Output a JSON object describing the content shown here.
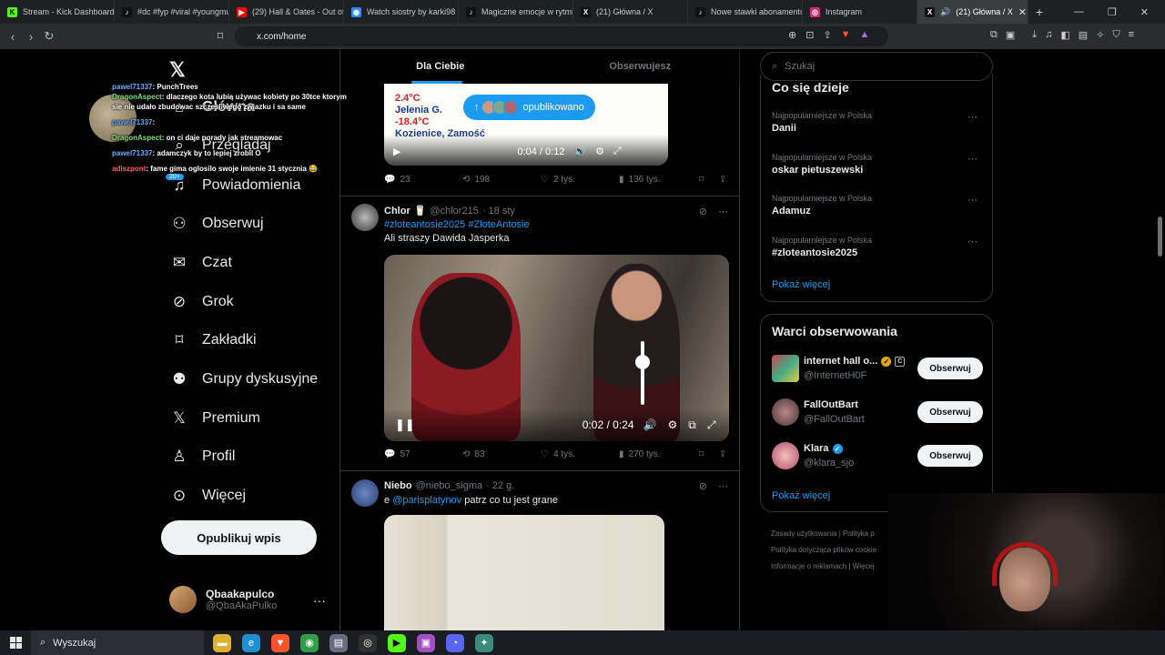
{
  "browser": {
    "tabs": [
      {
        "label": "Stream - Kick Dashboard",
        "favicon_color": "#53fc18",
        "favicon_glyph": "K"
      },
      {
        "label": "#dc #fyp #viral #youngmu",
        "favicon_color": "#111111",
        "favicon_glyph": "♪"
      },
      {
        "label": "(29) Hall & Oates - Out of",
        "favicon_color": "#ff0000",
        "favicon_glyph": "▶"
      },
      {
        "label": "Watch siostry by karki98",
        "favicon_color": "#2a8cff",
        "favicon_glyph": "◉"
      },
      {
        "label": "Magiczne emocje w rytmie",
        "favicon_color": "#111111",
        "favicon_glyph": "♪"
      },
      {
        "label": "(21) Główna / X",
        "favicon_color": "#111111",
        "favicon_glyph": "X"
      },
      {
        "label": "Nowe stawki abonamentu",
        "favicon_color": "#111111",
        "favicon_glyph": "♪"
      },
      {
        "label": "Instagram",
        "favicon_color": "#d62976",
        "favicon_glyph": "◎"
      }
    ],
    "active_tab": {
      "label": "(21) Główna / X",
      "favicon_glyph": "X"
    },
    "url": "x.com/home"
  },
  "stream_chat": {
    "messages": [
      {
        "user": "pawel71337",
        "text": "PunchTrees",
        "color": "#6ea8ff"
      },
      {
        "user": "DragonAspect",
        "text": "dlaczego kota lubią używac kobiety po 30tce ktorym sie nie udało zbudowac szczesliwego zwiazku i sa same",
        "color": "#7ee07e"
      },
      {
        "user": "pawel71337",
        "text": "",
        "color": "#6ea8ff"
      },
      {
        "user": "DragonAspect",
        "text": "on ci daje porady jak streamowac",
        "color": "#7ee07e"
      },
      {
        "user": "pawel71337",
        "text": "adamczyk by to lepiej zrobil O",
        "color": "#6ea8ff"
      },
      {
        "user": "adiszpont",
        "text": "fame gima oglosilo swoje imienie 31 stycznia 😂",
        "color": "#ff5b5b"
      }
    ],
    "badge": "20+"
  },
  "left_nav": {
    "items": [
      {
        "label": "Główna",
        "icon": "home-icon",
        "glyph": "⌂"
      },
      {
        "label": "Przeglądaj",
        "icon": "search-icon",
        "glyph": "⌕"
      },
      {
        "label": "Powiadomienia",
        "icon": "bell-icon",
        "glyph": "🔔"
      },
      {
        "label": "Obserwuj",
        "icon": "follow-icon",
        "glyph": "👤"
      },
      {
        "label": "Czat",
        "icon": "mail-icon",
        "glyph": "✉"
      },
      {
        "label": "Grok",
        "icon": "grok-icon",
        "glyph": "⊘"
      },
      {
        "label": "Zakładki",
        "icon": "bookmark-icon",
        "glyph": "🔖"
      },
      {
        "label": "Grupy dyskusyjne",
        "icon": "communities-icon",
        "glyph": "👥"
      },
      {
        "label": "Premium",
        "icon": "x-icon",
        "glyph": "𝕏"
      },
      {
        "label": "Profil",
        "icon": "profile-icon",
        "glyph": "👤"
      },
      {
        "label": "Więcej",
        "icon": "more-icon",
        "glyph": "⋯"
      }
    ],
    "post_button": "Opublikuj wpis",
    "account": {
      "name": "Qbaakapulco",
      "handle": "@QbaAkaPulko",
      "more": "···"
    }
  },
  "timeline": {
    "tabs": [
      "Dla Ciebie",
      "Obserwujesz"
    ],
    "new_posts_pill": "opublikowano",
    "post1": {
      "weather_lines": [
        "2.4°C",
        "Jelenia G.",
        "-18.4°C",
        "Kozienice, Zamość"
      ],
      "video_time": "0:04 / 0:12",
      "replies": "23",
      "reposts": "198",
      "likes": "2 tys.",
      "views": "136 tys."
    },
    "post2": {
      "name": "Chlor",
      "badge_glyph": "🥛",
      "handle": "@chlor215",
      "time": "· 18 sty",
      "hashtags": "#zloteantosie2025 #ZloteAntosie",
      "text": "Ali straszy Dawida Jasperka",
      "video_time": "0:02 / 0:24",
      "replies": "57",
      "reposts": "83",
      "likes": "4 tys.",
      "views": "270 tys."
    },
    "post3": {
      "name": "Niebo",
      "handle": "@niebo_sigma",
      "time": "· 22 g.",
      "prefix": "e ",
      "mention": "@parisplatynov",
      "text": " patrz co tu jest grane"
    }
  },
  "sidebar": {
    "search_placeholder": "Szukaj",
    "trends_title": "Co się dzieje",
    "trends": [
      {
        "category": "Najpopularniejsze w Polska",
        "name": "Danii"
      },
      {
        "category": "Najpopularniejsze w Polska",
        "name": "oskar pietuszewski"
      },
      {
        "category": "Najpopularniejsze w Polska",
        "name": "Adamuz"
      },
      {
        "category": "Najpopularniejsze w Polska",
        "name": "#zloteantosie2025"
      }
    ],
    "show_more": "Pokaż więcej",
    "who_title": "Warci obserwowania",
    "who": [
      {
        "name": "internet hall o...",
        "handle": "@InternetH0F",
        "verified": "gold",
        "extra_badge": "C"
      },
      {
        "name": "FallOutBart",
        "handle": "@FallOutBart",
        "verified": "",
        "extra_badge": ""
      },
      {
        "name": "Klara",
        "handle": "@klara_sjo",
        "verified": "blue",
        "extra_badge": ""
      }
    ],
    "follow_label": "Obserwuj",
    "show_more_2": "Pokaż więcej",
    "footer": [
      "Zasady użytkowania | Polityka p",
      "Polityka dotycząca plików cookie",
      "Informacje o reklamach | Więcej"
    ]
  },
  "taskbar": {
    "search_placeholder": "Wyszukaj",
    "apps": [
      "file-explorer",
      "edge",
      "brave",
      "chrome",
      "notes",
      "obs",
      "kick",
      "media",
      "discord",
      "app"
    ]
  }
}
